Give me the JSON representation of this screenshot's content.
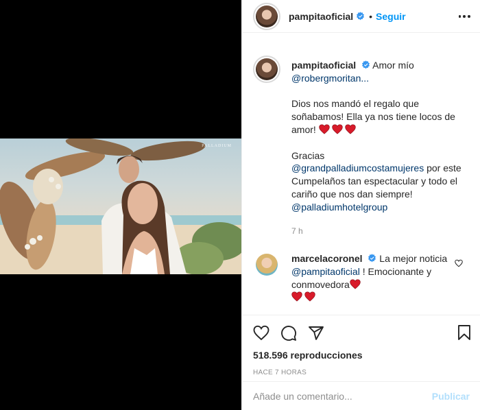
{
  "post": {
    "username": "pampitaoficial",
    "follow_label": "Seguir",
    "dot": "•",
    "watermark": "PALLADIUM"
  },
  "caption": {
    "username": "pampitaoficial",
    "text_1": "Amor mío",
    "mention_1": "@robergmoritan...",
    "para_2": "Dios nos mandó el regalo que soñabamos! Ella ya nos tiene locos de amor!",
    "para_3_pre": "Gracias",
    "mention_2": "@grandpalladiumcostamujeres",
    "para_3_mid": "por este Cumpelaños tan espectacular y todo el cariño que nos dan siempre!",
    "mention_3": "@palladiumhotelgroup",
    "time": "7 h"
  },
  "comment": {
    "username": "marcelacoronel",
    "text_1": "La mejor noticia",
    "mention": "@pampitaoficial",
    "text_2": "! Emocionante y conmovedora"
  },
  "stats": {
    "views": "518.596 reproducciones",
    "posted_ago": "HACE 7 HORAS"
  },
  "composer": {
    "placeholder": "Añade un comentario...",
    "publish_label": "Publicar"
  },
  "colors": {
    "link": "#00376b",
    "follow": "#0095f6",
    "muted": "#8e8e8e",
    "publish_disabled": "#b2dffc",
    "heart": "#ed4956"
  },
  "icons": [
    "verified-badge-icon",
    "more-options-icon",
    "heart-outline-icon",
    "comment-icon",
    "share-icon",
    "save-icon",
    "red-heart-icon"
  ]
}
